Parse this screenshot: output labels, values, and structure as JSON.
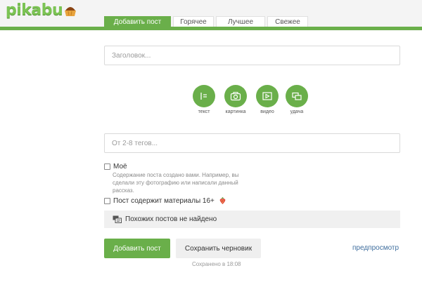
{
  "logo": {
    "text": "pikabu"
  },
  "tabs": [
    {
      "label": "Добавить пост",
      "active": true
    },
    {
      "label": "Горячее"
    },
    {
      "label": "Лучшее"
    },
    {
      "label": "Свежее"
    }
  ],
  "form": {
    "title_placeholder": "Заголовок...",
    "tags_placeholder": "От 2-8 тегов..."
  },
  "blocks": [
    {
      "label": "текст",
      "icon": "text-icon"
    },
    {
      "label": "картинка",
      "icon": "camera-icon"
    },
    {
      "label": "видео",
      "icon": "video-icon"
    },
    {
      "label": "удача",
      "icon": "luck-icon"
    }
  ],
  "mine": {
    "label": "Моё",
    "description": "Содержание поста создано вами. Например, вы сделали эту фотографию или написали данный рассказ."
  },
  "adult": {
    "label": "Пост содержит материалы 16+"
  },
  "similar": {
    "text": "Похожих постов не найдено"
  },
  "actions": {
    "add_label": "Добавить пост",
    "draft_label": "Сохранить черновик",
    "preview_label": "предпросмотр",
    "saved_text": "Сохранено в 18:08"
  },
  "colors": {
    "accent": "#6aaf4a",
    "link": "#3f6e9e"
  }
}
